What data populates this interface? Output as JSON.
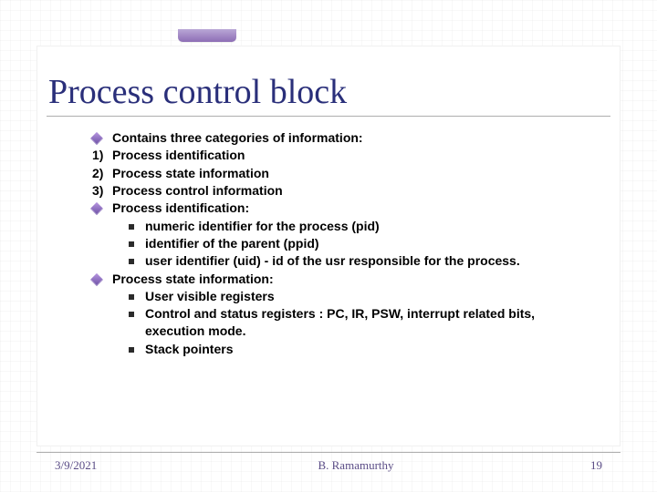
{
  "title": "Process control block",
  "bullets": {
    "b1": "Contains three categories of information:",
    "n1_num": "1)",
    "n1": "Process identification",
    "n2_num": "2)",
    "n2": "Process state information",
    "n3_num": "3)",
    "n3": "Process control information",
    "b2": "Process identification:",
    "b2_s1": "numeric identifier for the process (pid)",
    "b2_s2": "identifier of the parent (ppid)",
    "b2_s3": "user identifier (uid) - id of the usr responsible for the process.",
    "b3": "Process state information:",
    "b3_s1": "User visible registers",
    "b3_s2": "Control and status registers : PC, IR, PSW, interrupt related bits, execution mode.",
    "b3_s3": "Stack pointers"
  },
  "footer": {
    "date": "3/9/2021",
    "author": "B. Ramamurthy",
    "page": "19"
  }
}
